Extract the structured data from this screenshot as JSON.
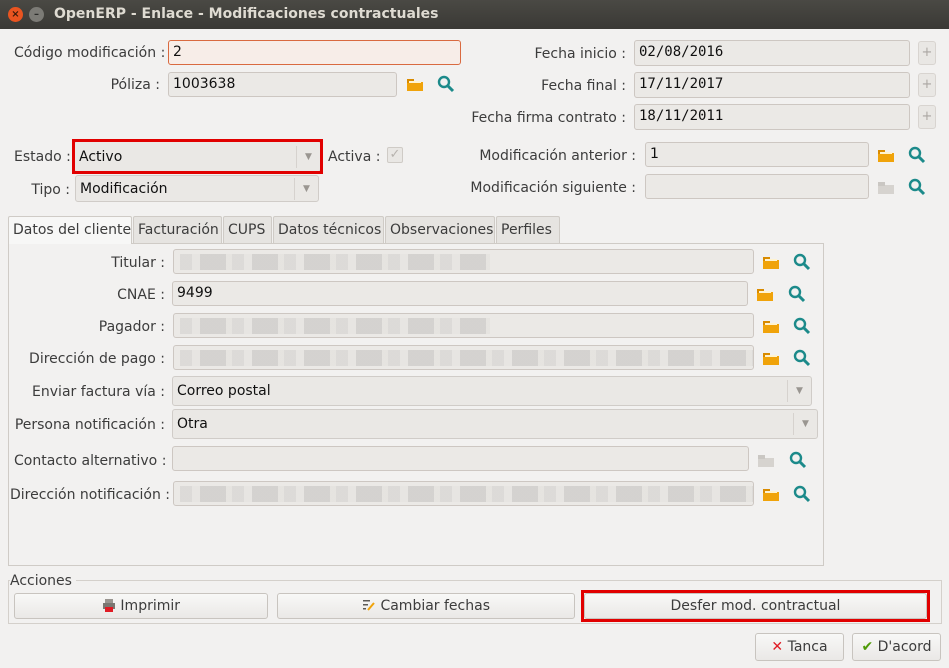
{
  "window": {
    "title": "OpenERP - Enlace - Modificaciones contractuales"
  },
  "header": {
    "codigo_label": "Código modificación :",
    "codigo_value": "2",
    "poliza_label": "Póliza :",
    "poliza_value": "1003638",
    "estado_label": "Estado :",
    "estado_value": "Activo",
    "activa_label": "Activa :",
    "tipo_label": "Tipo :",
    "tipo_value": "Modificación",
    "fecha_inicio_label": "Fecha inicio :",
    "fecha_inicio_value": "02/08/2016",
    "fecha_final_label": "Fecha final :",
    "fecha_final_value": "17/11/2017",
    "fecha_firma_label": "Fecha firma contrato :",
    "fecha_firma_value": "18/11/2011",
    "mod_anterior_label": "Modificación anterior :",
    "mod_anterior_value": "1",
    "mod_siguiente_label": "Modificación siguiente :",
    "mod_siguiente_value": ""
  },
  "tabs": [
    "Datos del cliente",
    "Facturación",
    "CUPS",
    "Datos técnicos",
    "Observaciones",
    "Perfiles"
  ],
  "cliente": {
    "titular_label": "Titular :",
    "cnae_label": "CNAE :",
    "cnae_value": "9499",
    "pagador_label": "Pagador :",
    "direccion_pago_label": "Dirección de pago :",
    "enviar_factura_label": "Enviar factura vía :",
    "enviar_factura_value": "Correo postal",
    "persona_notif_label": "Persona notificación :",
    "persona_notif_value": "Otra",
    "contacto_alt_label": "Contacto alternativo :",
    "direccion_notif_label": "Dirección notificación :"
  },
  "acciones": {
    "title": "Acciones",
    "imprimir": "Imprimir",
    "cambiar_fechas": "Cambiar fechas",
    "desfer": "Desfer mod. contractual"
  },
  "footer": {
    "cancel": "Tanca",
    "ok": "D'acord"
  },
  "colors": {
    "highlight": "#e10000",
    "accent": "#e95420",
    "folder": "#f0a30a",
    "search": "#1c8a8a"
  }
}
